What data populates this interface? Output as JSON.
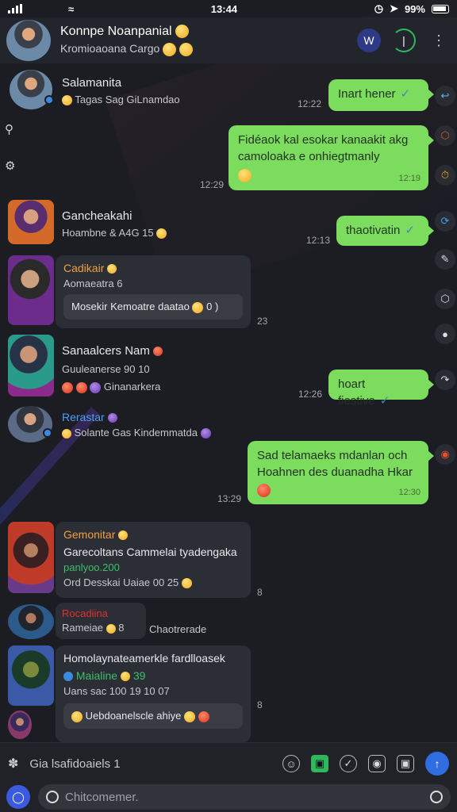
{
  "status_bar": {
    "time": "13:44",
    "battery": "99%"
  },
  "header": {
    "title": "Konnpe Noanpanial",
    "subtitle": "Kromioaoana Cargo",
    "btn_badge": "W"
  },
  "messages": [
    {
      "name": "Salamanita",
      "meta": "Tagas Sag GiLnamdao",
      "time": "12:22",
      "name_color": "#ffffff"
    },
    {
      "name": "Gancheakahi",
      "meta": "Hoambne & A4G 15",
      "time": "12:13",
      "name_color": "#ffffff"
    },
    {
      "name": "Cadikair",
      "meta": "Aomaeatra 6",
      "card": "Mosekir Kemoatre daatao",
      "card_tail": "0 )",
      "side_time": "23",
      "name_color": "#f0a040"
    },
    {
      "name": "Sanaalcers Nam",
      "meta": "Guuleanerse 90 10",
      "meta2": "Ginanarkera",
      "time": "12:26",
      "name_color": "#ffffff"
    },
    {
      "name": "Rerastar",
      "meta": "Solante Gas Kindemmatda",
      "name_color": "#4aa0f0"
    },
    {
      "name": "Gemonitar",
      "line1": "Garecoltans Cammelai tyadengaka",
      "line2": "panlyoo.200",
      "line3": "Ord Desskai Uaiae 00 25",
      "side_time": "8",
      "name_color": "#f0a040"
    },
    {
      "name": "Rocadiina",
      "meta": "Rameiae",
      "meta_num": "8",
      "meta2": "Chaotrerade",
      "name_color": "#e03030"
    },
    {
      "name": "Homolaynateamerkle fardlloasek",
      "line1": "Maialine",
      "line1_num": "39",
      "line2": "Uans sac 100 19 10 07",
      "card": "Uebdoanelscle ahiye",
      "side_time": "8",
      "name_color": "#ffffff"
    }
  ],
  "outgoing": [
    {
      "text": "Inart hener",
      "time": "12:22"
    },
    {
      "text": "Fidéaok kal esokar kanaakit akg camoloaka e onhiegtmanly",
      "time": "12:19",
      "left_time": "12:29"
    },
    {
      "text": "thaotivatin",
      "time": ""
    },
    {
      "text": "hoart fiestive",
      "time": ""
    },
    {
      "text": "Sad telamaeks mdanlan och Hoahnen des duanadha Hkar",
      "time": "12:30",
      "left_time": "13:29"
    }
  ],
  "composer": {
    "label": "Gia lsafidoaiels 1",
    "placeholder": "Chitcomemer."
  },
  "colors": {
    "accent_green": "#7bdc5e",
    "accent_blue": "#2f6de0"
  }
}
